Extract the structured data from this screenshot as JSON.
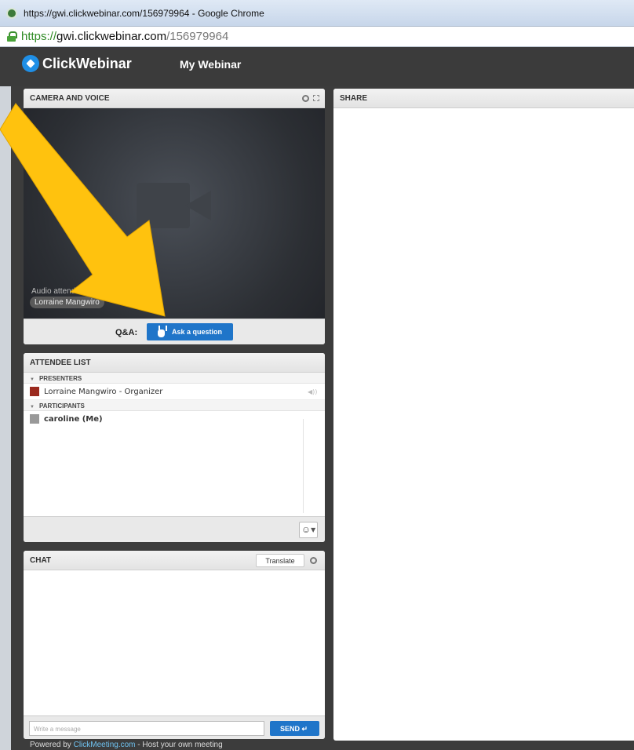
{
  "browser": {
    "window_title": "https://gwi.clickwebinar.com/156979964 - Google Chrome",
    "url_scheme": "https://",
    "url_host": "gwi.clickwebinar.com",
    "url_path": "/156979964"
  },
  "app": {
    "logo_text": "ClickWebinar",
    "title": "My Webinar"
  },
  "camera": {
    "header": "CAMERA AND VOICE",
    "audio_label": "Audio attendees",
    "presenter_name": "Lorraine Mangwiro",
    "qa_label": "Q&A:",
    "ask_button": "Ask a question"
  },
  "attendees": {
    "header": "ATTENDEE LIST",
    "presenters_label": "PRESENTERS",
    "presenters": [
      "Lorraine Mangwiro - Organizer"
    ],
    "participants_label": "PARTICIPANTS",
    "participants": [
      "caroline (Me)"
    ]
  },
  "chat": {
    "header": "CHAT",
    "translate_label": "Translate",
    "placeholder": "Write a message",
    "send_label": "SEND ↵"
  },
  "share": {
    "header": "SHARE"
  },
  "footer": {
    "prefix": "Powered by ",
    "link": "ClickMeeting.com",
    "suffix": " - Host your own meeting"
  },
  "colors": {
    "accent": "#1f75c9",
    "arrow": "#ffc20e",
    "header_bg": "#3b3b3b"
  }
}
